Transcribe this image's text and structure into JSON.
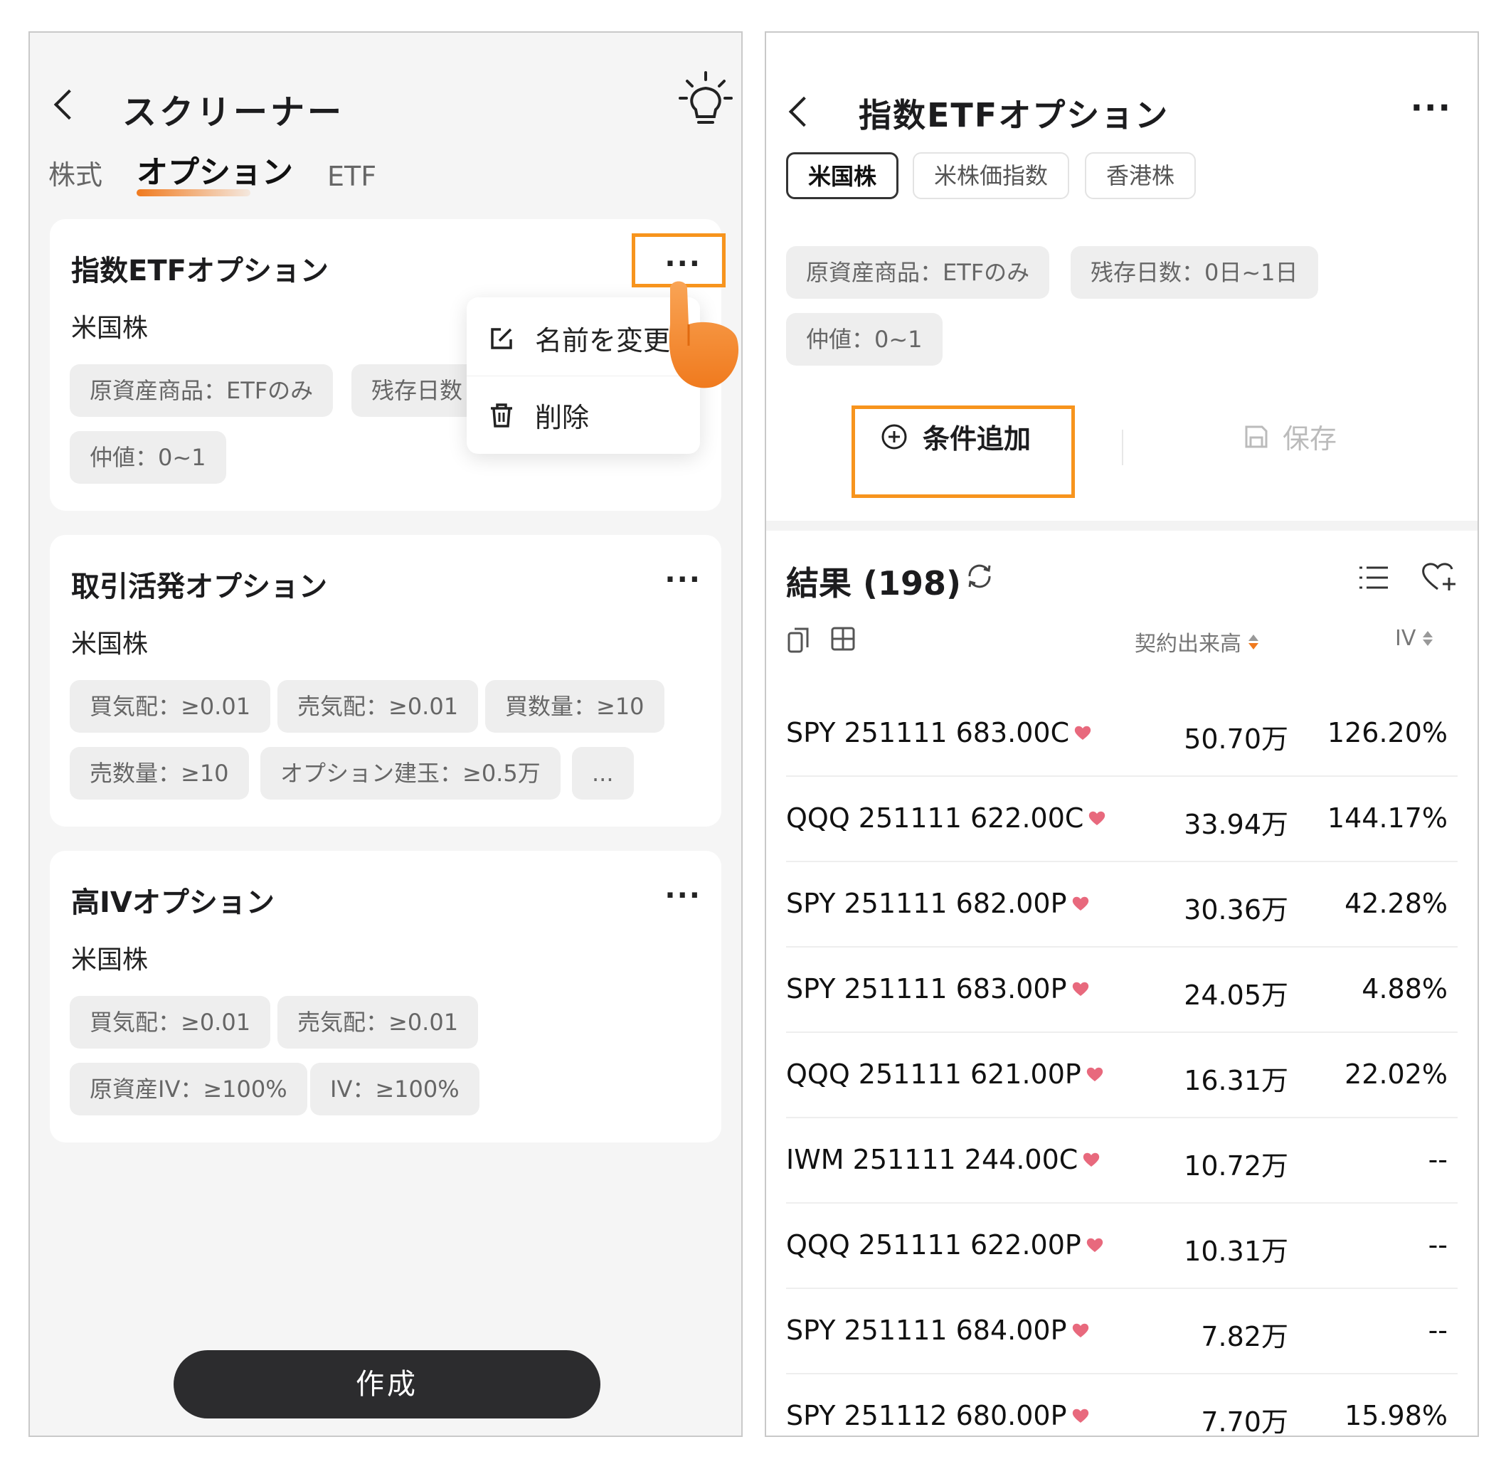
{
  "left": {
    "title": "スクリーナー",
    "tabs": [
      "株式",
      "オプション",
      "ETF"
    ],
    "cards": [
      {
        "title": "指数ETFオプション",
        "market": "米国株",
        "more": "···",
        "chips": [
          "原資産商品：ETFのみ",
          "残存日数",
          "仲値：0~1"
        ]
      },
      {
        "title": "取引活発オプション",
        "market": "米国株",
        "more": "···",
        "chips": [
          "買気配：≥0.01",
          "売気配：≥0.01",
          "買数量：≥10",
          "売数量：≥10",
          "オプション建玉：≥0.5万",
          "..."
        ]
      },
      {
        "title": "高IVオプション",
        "market": "米国株",
        "more": "···",
        "chips": [
          "買気配：≥0.01",
          "売気配：≥0.01",
          "原資産IV：≥100%",
          "IV：≥100%"
        ]
      }
    ],
    "menu": {
      "rename": "名前を変更",
      "delete": "削除"
    },
    "create_button": "作成"
  },
  "right": {
    "title": "指数ETFオプション",
    "more": "···",
    "market_tabs": [
      "米国株",
      "米株価指数",
      "香港株"
    ],
    "filters": [
      "原資産商品：ETFのみ",
      "残存日数：0日~1日",
      "仲値：0~1"
    ],
    "add_condition": "条件追加",
    "save": "保存",
    "results_title": "結果 (198)",
    "columns": {
      "volume": "契約出来高",
      "iv": "IV"
    },
    "rows": [
      {
        "symbol": "SPY 251111 683.00C",
        "volume": "50.70万",
        "iv": "126.20%"
      },
      {
        "symbol": "QQQ 251111 622.00C",
        "volume": "33.94万",
        "iv": "144.17%"
      },
      {
        "symbol": "SPY 251111 682.00P",
        "volume": "30.36万",
        "iv": "42.28%"
      },
      {
        "symbol": "SPY 251111 683.00P",
        "volume": "24.05万",
        "iv": "4.88%"
      },
      {
        "symbol": "QQQ 251111 621.00P",
        "volume": "16.31万",
        "iv": "22.02%"
      },
      {
        "symbol": "IWM 251111 244.00C",
        "volume": "10.72万",
        "iv": "--"
      },
      {
        "symbol": "QQQ 251111 622.00P",
        "volume": "10.31万",
        "iv": "--"
      },
      {
        "symbol": "SPY 251111 684.00P",
        "volume": "7.82万",
        "iv": "--"
      },
      {
        "symbol": "SPY 251112 680.00P",
        "volume": "7.70万",
        "iv": "15.98%"
      }
    ]
  },
  "colors": {
    "accent": "#f7941d",
    "heart": "#e8697d",
    "button_dark": "#2c2c2e"
  },
  "icons": [
    "back-icon",
    "lightbulb-icon",
    "edit-icon",
    "trash-icon",
    "pointing-hand-icon",
    "plus-circle-icon",
    "save-icon",
    "refresh-icon",
    "list-icon",
    "heart-add-icon",
    "copy-icon",
    "grid-icon",
    "heart-icon",
    "sort-icon"
  ]
}
